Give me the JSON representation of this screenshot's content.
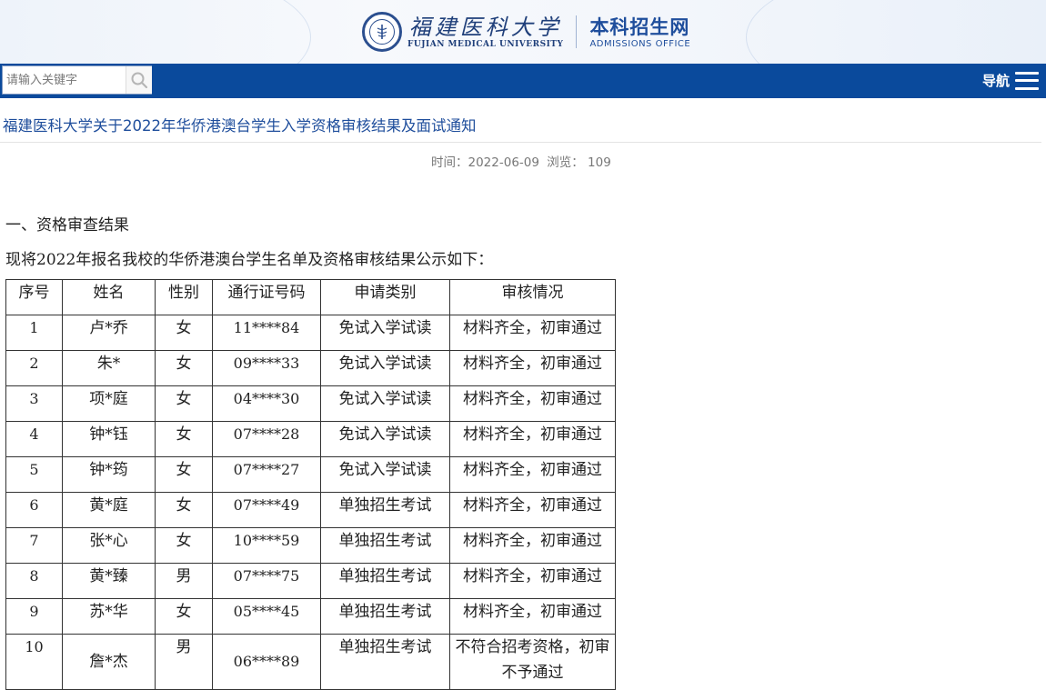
{
  "header": {
    "university_cn": "福建医科大学",
    "university_en": "FUJIAN MEDICAL UNIVERSITY",
    "office_cn": "本科招生网",
    "office_en": "ADMISSIONS OFFICE",
    "seal_icon": "university-seal-icon"
  },
  "navbar": {
    "search_placeholder": "请输入关键字",
    "search_icon": "search-icon",
    "nav_label": "导航",
    "menu_icon": "hamburger-menu-icon",
    "bar_color": "#0a4a9c"
  },
  "article": {
    "title": "福建医科大学关于2022年华侨港澳台学生入学资格审核结果及面试通知",
    "meta_time": "时间：2022-06-09",
    "meta_views": "浏览： 109",
    "section_heading": "一、资格审查结果",
    "intro": "现将2022年报名我校的华侨港澳台学生名单及资格审核结果公示如下："
  },
  "table": {
    "headers": [
      "序号",
      "姓名",
      "性别",
      "通行证号码",
      "申请类别",
      "审核情况"
    ],
    "rows": [
      [
        "1",
        "卢*乔",
        "女",
        "11****84",
        "免试入学试读",
        "材料齐全，初审通过"
      ],
      [
        "2",
        "朱*",
        "女",
        "09****33",
        "免试入学试读",
        "材料齐全，初审通过"
      ],
      [
        "3",
        "项*庭",
        "女",
        "04****30",
        "免试入学试读",
        "材料齐全，初审通过"
      ],
      [
        "4",
        "钟*钰",
        "女",
        "07****28",
        "免试入学试读",
        "材料齐全，初审通过"
      ],
      [
        "5",
        "钟*筠",
        "女",
        "07****27",
        "免试入学试读",
        "材料齐全，初审通过"
      ],
      [
        "6",
        "黄*庭",
        "女",
        "07****49",
        "单独招生考试",
        "材料齐全，初审通过"
      ],
      [
        "7",
        "张*心",
        "女",
        "10****59",
        "单独招生考试",
        "材料齐全，初审通过"
      ],
      [
        "8",
        "黄*臻",
        "男",
        "07****75",
        "单独招生考试",
        "材料齐全，初审通过"
      ],
      [
        "9",
        "苏*华",
        "女",
        "05****45",
        "单独招生考试",
        "材料齐全，初审通过"
      ],
      [
        "10",
        "詹*杰",
        "男",
        "06****89",
        "单独招生考试",
        "不符合招考资格，初审不予通过"
      ]
    ]
  }
}
